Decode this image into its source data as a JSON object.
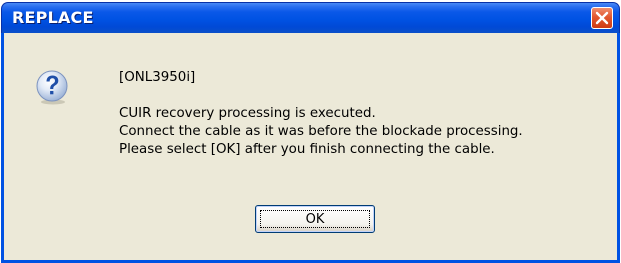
{
  "window": {
    "title": "REPLACE",
    "close_icon": "close-icon",
    "colors": {
      "titlebar": "#0052e3",
      "client_bg": "#ece9d8",
      "close_button": "#e2572f"
    }
  },
  "dialog": {
    "icon": "question-icon",
    "message": {
      "device": "[ONL3950i]",
      "line1": "CUIR recovery processing is executed.",
      "line2": "Connect the cable as it was before the blockade processing.",
      "line3": "Please select [OK] after you finish connecting the cable."
    },
    "ok_label": "OK"
  }
}
